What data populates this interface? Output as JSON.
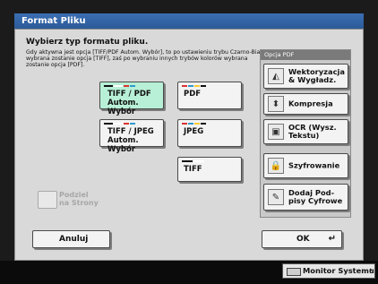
{
  "window": {
    "title": "Format Pliku"
  },
  "main": {
    "heading": "Wybierz typ formatu pliku.",
    "description": "Gdy aktywna jest opcja [TIFF/PDF Autom. Wybór], to po ustawieniu trybu Czarno-Biały wybrana zostanie opcja [TIFF], zaś po wybraniu innych trybów kolorów wybrana zostanie opcja [PDF].",
    "formats": {
      "tiff_pdf_auto": {
        "line1": "TIFF / PDF",
        "line2": "Autom. Wybór",
        "selected": true
      },
      "pdf": {
        "label": "PDF"
      },
      "tiff_jpeg_auto": {
        "line1": "TIFF / JPEG",
        "line2": "Autom. Wybór"
      },
      "jpeg": {
        "label": "JPEG"
      },
      "tiff": {
        "label": "TIFF"
      }
    },
    "split_pages": {
      "line1": "Podziel",
      "line2": "na Strony"
    }
  },
  "pdf_options": {
    "header": "Opcja PDF",
    "items": [
      {
        "line1": "Wektoryzacja",
        "line2": "& Wygładz.",
        "icon": "vector-icon"
      },
      {
        "line1": "Kompresja",
        "line2": "",
        "icon": "compression-icon"
      },
      {
        "line1": "OCR (Wysz.",
        "line2": "Tekstu)",
        "icon": "ocr-icon"
      },
      {
        "line1": "Szyfrowanie",
        "line2": "",
        "icon": "encryption-icon"
      },
      {
        "line1": "Dodaj Pod-",
        "line2": "pisy Cyfrowe",
        "icon": "digital-signature-icon"
      }
    ]
  },
  "footer": {
    "cancel_label": "Anuluj",
    "ok_label": "OK"
  },
  "statusbar": {
    "monitor_label": "Monitor Systemu"
  },
  "colors": {
    "title_blue": "#2c5a98",
    "selected_green": "#b7f0d6",
    "panel_gray": "#d9d9d9"
  }
}
